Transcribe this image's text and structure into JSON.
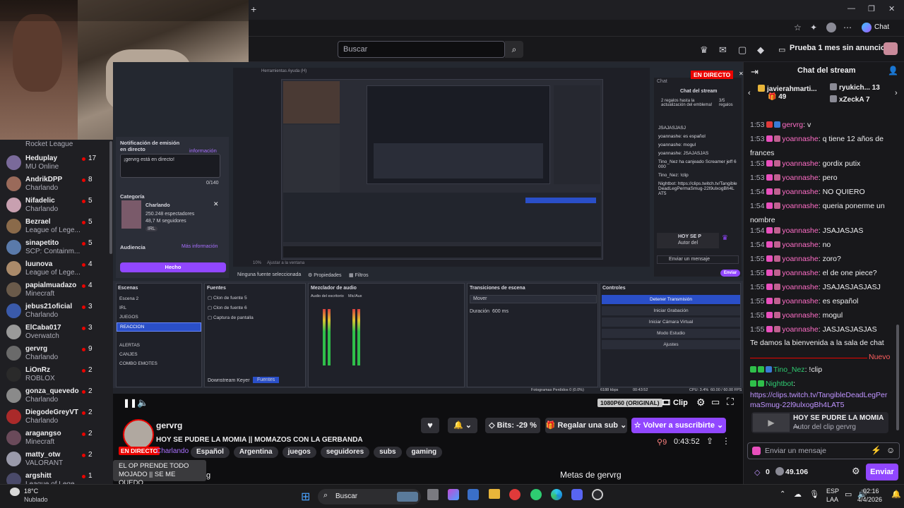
{
  "browser": {
    "new_tab": "+",
    "chat_button": "Chat",
    "minimize": "—",
    "restore": "❐",
    "close": "✕"
  },
  "topnav": {
    "search_placeholder": "Buscar",
    "promo": "Prueba 1 mes sin anuncios"
  },
  "sidebar": {
    "top_game": "Rocket League",
    "channels": [
      {
        "name": "Heduplay",
        "game": "MU Online",
        "count": "17"
      },
      {
        "name": "AndrikDPP",
        "game": "Charlando",
        "count": "8"
      },
      {
        "name": "Nifadelic",
        "game": "Charlando",
        "count": "5"
      },
      {
        "name": "Bezrael",
        "game": "League of Lege...",
        "count": "5"
      },
      {
        "name": "sinapetito",
        "game": "SCP: Containm...",
        "count": "5"
      },
      {
        "name": "luunova",
        "game": "League of Lege...",
        "count": "4"
      },
      {
        "name": "papialmuadazo",
        "game": "Minecraft",
        "count": "4"
      },
      {
        "name": "jebus21oficial",
        "game": "Charlando",
        "count": "3"
      },
      {
        "name": "ElCaba017",
        "game": "Overwatch",
        "count": "3"
      },
      {
        "name": "gervrg",
        "game": "Charlando",
        "count": "9"
      },
      {
        "name": "LiOnRz",
        "game": "ROBLOX",
        "count": "2"
      },
      {
        "name": "gonza_quevedo",
        "game": "Charlando",
        "count": "2"
      },
      {
        "name": "DiegodeGreyVT",
        "game": "Charlando",
        "count": "2"
      },
      {
        "name": "aragangso",
        "game": "Minecraft",
        "count": "2"
      },
      {
        "name": "matty_otw",
        "game": "VALORANT",
        "count": "2"
      },
      {
        "name": "argshitt",
        "game": "League of Lege",
        "count": "1"
      }
    ]
  },
  "stream_overlay": {
    "live_badge": "EN DIRECTO",
    "notif_title": "Notificación de emisión en directo",
    "notif_info": "información",
    "notif_text": "¡gervrg está en directo!",
    "notif_counter": "0/140",
    "category_label": "Categoría",
    "category_name": "Charlando",
    "category_viewers": "250.248 espectadores",
    "category_followers": "48,7 M seguidores",
    "category_tag": "IRL",
    "audience_label": "Audiencia",
    "audience_more": "Más información",
    "done_button": "Hecho",
    "no_source": "Ninguna fuente seleccionada",
    "properties": "Propiedades",
    "filters": "Filtros",
    "mini_chat_title": "Chat del stream",
    "mini_chat_gift": "2 regalos hasta la actualización del emblema!",
    "mini_chat_gift_count": "3/5 regalos",
    "mini_chat_msgs": [
      "JSAJASJASJ",
      "yoannashe: es español",
      "yoannashe: mogul",
      "yoannashe: JSAJASJAS",
      "Tino_Nez ha canjeado Screamer jeff 6000",
      "Tino_Nez: !clip",
      "Nightbot: https://clips.twitch.tv/TangibleDeadLegPermaSmug-22l9ulxogBh4LAT5"
    ],
    "mini_chat_clip": "HOY SE P",
    "mini_chat_clip_author": "Autor del",
    "mini_chat_input": "Enviar un mensaje",
    "mini_chat_send": "Enviar"
  },
  "obs": {
    "scenes_title": "Escenas",
    "scenes": [
      "Escena 2",
      "IRL",
      "JUEGOS",
      "REACCION",
      "ALERTAS",
      "CANJES",
      "COMBO EMOTES"
    ],
    "sources_title": "Fuentes",
    "sources": [
      "Clon de fuente 5",
      "Clon de fuente 6",
      "Captura de pantalla"
    ],
    "mixer_title": "Mezclador de audio",
    "mixer_ch1": "Audio del escritorio",
    "mixer_ch2": "Mic/Aux",
    "transitions_title": "Transiciones de escena",
    "transition_value": "Mover",
    "duration_label": "Duración",
    "duration_value": "600 ms",
    "controls_title": "Controles",
    "controls": [
      "Detener Transmisión",
      "Iniciar Grabación",
      "Iniciar Cámara Virtual",
      "Modo Estudio",
      "Ajustes"
    ],
    "downstream": "Downstream Keyer",
    "sources_tab": "Fuentes",
    "status_frames": "Fotogramas Perdidos 0 (0.0%)",
    "status_kbps": "6188 kbps",
    "status_time": "00:43:52",
    "status_cpu": "CPU: 3.4%",
    "status_fps": "60.00 / 60.00 FPS",
    "zoom": "10%",
    "fit": "Ajustar a la ventana"
  },
  "player": {
    "quality": "1080P60 (ORIGINAL)",
    "clip": "Clip"
  },
  "info": {
    "live_badge": "EN DIRECTO",
    "channel": "gervrg",
    "title": "HOY SE PUDRE LA MOMIA || MOMAZOS CON LA GERBANDA",
    "category": "Charlando",
    "tags": [
      "Español",
      "Argentina",
      "juegos",
      "seguidores",
      "subs",
      "gaming"
    ],
    "bits": "Bits: -29 %",
    "gift": "Regalar una sub",
    "resub": "Volver a suscribirte",
    "viewers": "9",
    "uptime": "0:43:52",
    "tooltip": "EL OP PRENDE TODO MOJADO || SE ME QUEDO...",
    "goals": "Metas de gervrg",
    "trailing": "g"
  },
  "chat": {
    "title": "Chat del stream",
    "gifters": [
      {
        "name": "javierahmarti...",
        "count": "49"
      },
      {
        "name": "ryukich...",
        "count": "13"
      },
      {
        "name": "xZeckA",
        "count": "7"
      }
    ],
    "messages": [
      {
        "time": "1:53",
        "user": "gervrg",
        "text": ": v"
      },
      {
        "time": "1:53",
        "user": "yoannashe",
        "text": ": q tiene 12 años de"
      },
      {
        "time": "",
        "user": "",
        "text": "frances"
      },
      {
        "time": "1:53",
        "user": "yoannashe",
        "text": ": gordix putix"
      },
      {
        "time": "1:53",
        "user": "yoannashe",
        "text": ": pero"
      },
      {
        "time": "1:54",
        "user": "yoannashe",
        "text": ": NO QUIERO"
      },
      {
        "time": "1:54",
        "user": "yoannashe",
        "text": ": queria ponerme un"
      },
      {
        "time": "",
        "user": "",
        "text": "nombre"
      },
      {
        "time": "1:54",
        "user": "yoannashe",
        "text": ": JSAJASJAS"
      },
      {
        "time": "1:54",
        "user": "yoannashe",
        "text": ": no"
      },
      {
        "time": "1:55",
        "user": "yoannashe",
        "text": ": zoro?"
      },
      {
        "time": "1:55",
        "user": "yoannashe",
        "text": ": el de one piece?"
      },
      {
        "time": "1:55",
        "user": "yoannashe",
        "text": ": JSAJASJASJASJ"
      },
      {
        "time": "1:55",
        "user": "yoannashe",
        "text": ": es español"
      },
      {
        "time": "1:55",
        "user": "yoannashe",
        "text": ": mogul"
      },
      {
        "time": "1:55",
        "user": "yoannashe",
        "text": ": JASJASJASJAS"
      }
    ],
    "welcome": "Te damos la bienvenida a la sala de chat",
    "new_label": "Nuevo",
    "tino": "Tino_Nez",
    "tino_msg": ": !clip",
    "nightbot": "Nightbot",
    "nightbot_link": "https://clips.twitch.tv/TangibleDeadLegPermaSmug-22l9ulxogBh4LAT5",
    "clip_title": "HOY SE PUDRE LA MOMIA ...",
    "clip_author": "Autor del clip gervrg",
    "input_placeholder": "Enviar un mensaje",
    "points_zero": "0",
    "points": "49.106",
    "send": "Enviar"
  },
  "taskbar": {
    "weather_temp": "18°C",
    "weather_desc": "Nublado",
    "search": "Buscar",
    "lang1": "ESP",
    "lang2": "LAA",
    "time": "02:16",
    "date": "4/4/2026"
  },
  "colors": {
    "twitch_purple": "#9147ff",
    "live_red": "#eb0400",
    "chat_pink": "#ff6ec7",
    "obs_blue": "#2a4fc8"
  }
}
